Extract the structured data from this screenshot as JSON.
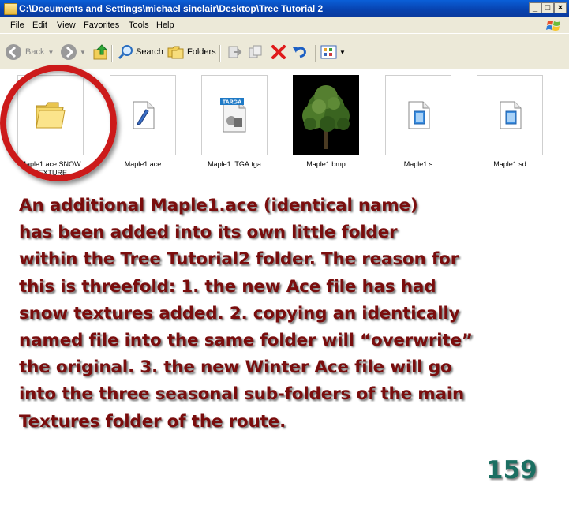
{
  "window": {
    "title": "C:\\Documents and Settings\\michael sinclair\\Desktop\\Tree Tutorial 2",
    "controls": [
      "minimize",
      "maximize",
      "close"
    ]
  },
  "menu": [
    "File",
    "Edit",
    "View",
    "Favorites",
    "Tools",
    "Help"
  ],
  "toolbar": {
    "back_label": "Back",
    "search_label": "Search",
    "folders_label": "Folders"
  },
  "files": [
    {
      "name": "Maple1.ace  SNOW TEXTURE",
      "type": "folder",
      "icon": "folder-icon"
    },
    {
      "name": "Maple1.ace",
      "type": "ace",
      "icon": "ace-file-icon"
    },
    {
      "name": "Maple1. TGA.tga",
      "type": "tga",
      "icon": "targa-file-icon",
      "badge": "TARGA"
    },
    {
      "name": "Maple1.bmp",
      "type": "bmp",
      "icon": "tree-thumbnail"
    },
    {
      "name": "Maple1.s",
      "type": "s",
      "icon": "generic-file-icon"
    },
    {
      "name": "Maple1.sd",
      "type": "sd",
      "icon": "generic-file-icon"
    }
  ],
  "caption": {
    "lines": [
      "An additional Maple1.ace (identical name)",
      "has been added into its own little folder",
      "within the Tree Tutorial2 folder. The reason for",
      "this is threefold: 1. the new Ace file has had",
      "snow textures added. 2. copying an identically",
      "named file into the same folder will “overwrite”",
      "the original.  3. the new Winter Ace file will go",
      "into the three seasonal sub-folders of the main",
      "Textures folder of the route."
    ]
  },
  "page_number": "159",
  "colors": {
    "title_bar": "#0a47b6",
    "chrome": "#ece9d8",
    "highlight_circle": "#cc1a1a",
    "caption_text": "#7a0d0d",
    "page_number": "#1b6f62"
  }
}
